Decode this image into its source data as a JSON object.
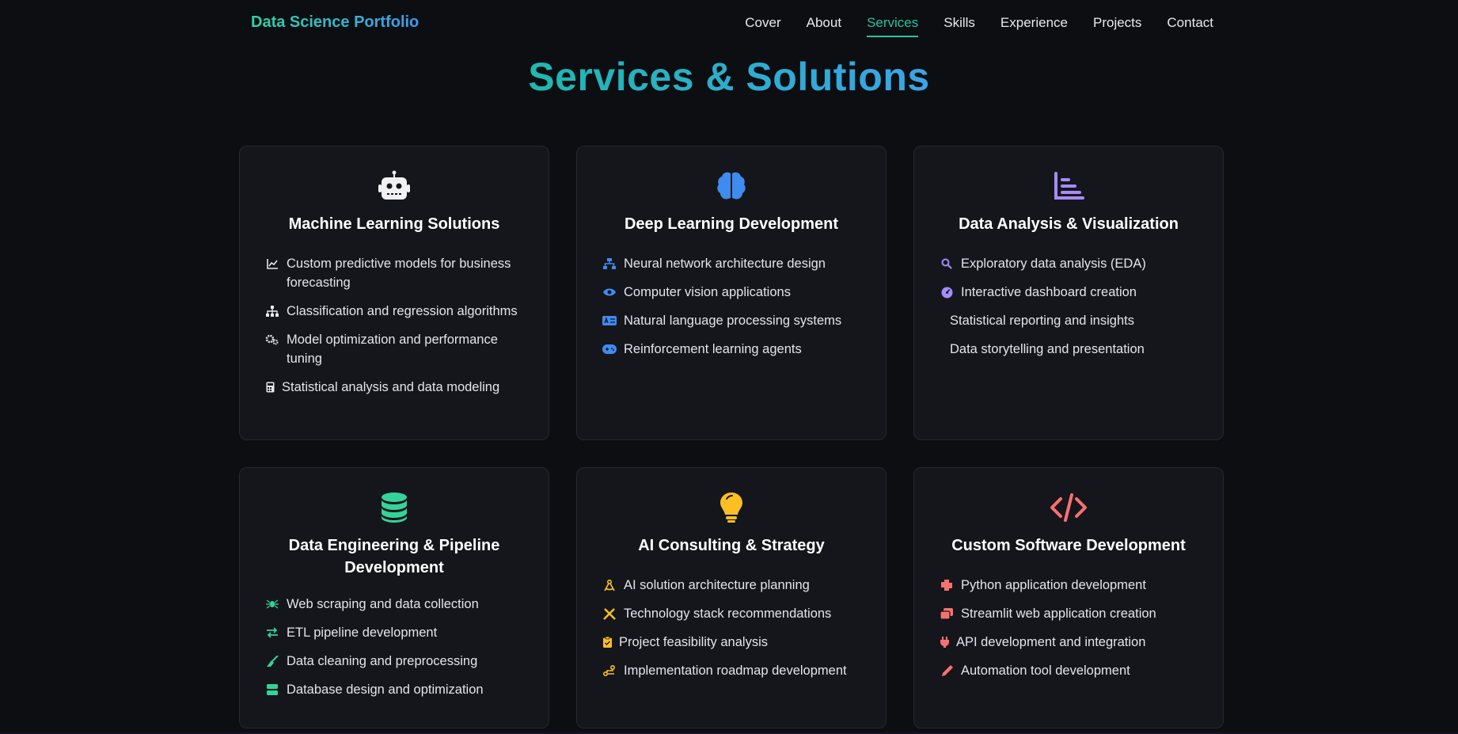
{
  "brand": "Data Science Portfolio",
  "nav": [
    "Cover",
    "About",
    "Services",
    "Skills",
    "Experience",
    "Projects",
    "Contact"
  ],
  "active_nav": "Services",
  "page_title": "Services & Solutions",
  "colors": {
    "accent": "#22c4a4",
    "blue": "#3b9cf0",
    "purple": "#a78bfa",
    "green": "#34d399",
    "yellow": "#fbbf24",
    "red": "#f87171"
  },
  "cards": [
    {
      "icon": "robot-icon",
      "title": "Machine Learning Solutions",
      "items": [
        {
          "icon": "line-chart-icon",
          "text": "Custom predictive models for business forecasting"
        },
        {
          "icon": "sitemap-icon",
          "text": "Classification and regression algorithms"
        },
        {
          "icon": "gears-icon",
          "text": "Model optimization and performance tuning"
        },
        {
          "icon": "calculator-icon",
          "text": "Statistical analysis and data modeling"
        }
      ]
    },
    {
      "icon": "brain-icon",
      "title": "Deep Learning Development",
      "items": [
        {
          "icon": "network-icon",
          "text": "Neural network architecture design"
        },
        {
          "icon": "eye-icon",
          "text": "Computer vision applications"
        },
        {
          "icon": "language-icon",
          "text": "Natural language processing systems"
        },
        {
          "icon": "gamepad-icon",
          "text": "Reinforcement learning agents"
        }
      ]
    },
    {
      "icon": "bar-chart-icon",
      "title": "Data Analysis & Visualization",
      "items": [
        {
          "icon": "search-icon",
          "text": "Exploratory data analysis (EDA)"
        },
        {
          "icon": "dashboard-icon",
          "text": "Interactive dashboard creation"
        },
        {
          "icon": "",
          "text": "Statistical reporting and insights"
        },
        {
          "icon": "",
          "text": "Data storytelling and presentation"
        }
      ]
    },
    {
      "icon": "database-icon",
      "title": "Data Engineering & Pipeline Development",
      "items": [
        {
          "icon": "spider-icon",
          "text": "Web scraping and data collection"
        },
        {
          "icon": "exchange-icon",
          "text": "ETL pipeline development"
        },
        {
          "icon": "broom-icon",
          "text": "Data cleaning and preprocessing"
        },
        {
          "icon": "server-icon",
          "text": "Database design and optimization"
        }
      ]
    },
    {
      "icon": "lightbulb-icon",
      "title": "AI Consulting & Strategy",
      "items": [
        {
          "icon": "compass-drafting-icon",
          "text": "AI solution architecture planning"
        },
        {
          "icon": "tools-icon",
          "text": "Technology stack recommendations"
        },
        {
          "icon": "clipboard-check-icon",
          "text": "Project feasibility analysis"
        },
        {
          "icon": "route-icon",
          "text": "Implementation roadmap development"
        }
      ]
    },
    {
      "icon": "code-icon",
      "title": "Custom Software Development",
      "items": [
        {
          "icon": "python-icon",
          "text": "Python application development"
        },
        {
          "icon": "window-restore-icon",
          "text": "Streamlit web application creation"
        },
        {
          "icon": "plug-icon",
          "text": "API development and integration"
        },
        {
          "icon": "pen-icon",
          "text": "Automation tool development"
        }
      ]
    }
  ]
}
